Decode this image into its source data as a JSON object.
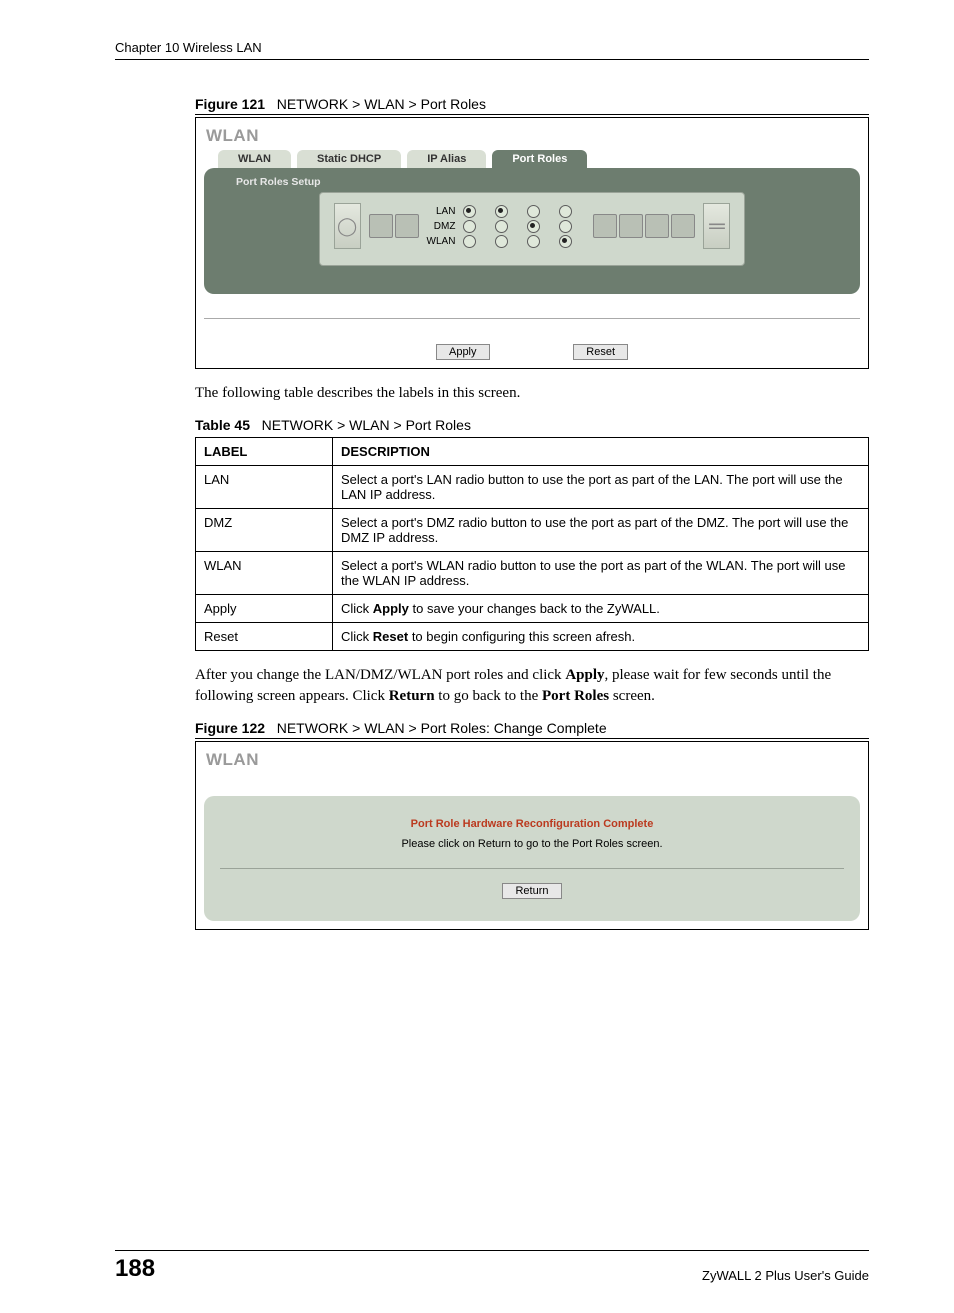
{
  "header": {
    "chapter": "Chapter 10 Wireless LAN"
  },
  "figure1": {
    "caption_num": "Figure 121",
    "caption_text": "NETWORK > WLAN > Port Roles",
    "title": "WLAN",
    "tabs": [
      "WLAN",
      "Static DHCP",
      "IP Alias",
      "Port Roles"
    ],
    "active_tab": 3,
    "panel_head": "Port Roles Setup",
    "row_labels": [
      "LAN",
      "DMZ",
      "WLAN"
    ],
    "selections": [
      [
        true,
        true,
        false,
        false
      ],
      [
        false,
        false,
        true,
        false
      ],
      [
        false,
        false,
        false,
        true
      ]
    ],
    "buttons": {
      "apply": "Apply",
      "reset": "Reset"
    }
  },
  "text1": "The following table describes the labels in this screen.",
  "table": {
    "caption_num": "Table 45",
    "caption_text": "NETWORK > WLAN > Port Roles",
    "headers": [
      "LABEL",
      "DESCRIPTION"
    ],
    "rows": [
      {
        "label": "LAN",
        "desc": "Select a port's LAN radio button to use the port as part of the LAN. The port will use the LAN IP address."
      },
      {
        "label": "DMZ",
        "desc": "Select a port's DMZ radio button to use the port as part of the DMZ. The port will use the DMZ IP address."
      },
      {
        "label": "WLAN",
        "desc": "Select a port's WLAN radio button to use the port as part of the WLAN. The port will use the WLAN IP address."
      },
      {
        "label": "Apply",
        "desc_pre": "Click ",
        "desc_bold": "Apply",
        "desc_post": " to save your changes back to the ZyWALL."
      },
      {
        "label": "Reset",
        "desc_pre": "Click ",
        "desc_bold": "Reset",
        "desc_post": " to begin configuring this screen afresh."
      }
    ]
  },
  "text2": {
    "p1a": "After you change the LAN/DMZ/WLAN port roles and click ",
    "b1": "Apply",
    "p1b": ", please wait for few seconds until the following screen appears. Click ",
    "b2": "Return",
    "p1c": " to go back to the ",
    "b3": "Port Roles",
    "p1d": " screen."
  },
  "figure2": {
    "caption_num": "Figure 122",
    "caption_text": "NETWORK > WLAN > Port Roles: Change Complete",
    "title": "WLAN",
    "msg_title": "Port Role Hardware Reconfiguration Complete",
    "msg_body": "Please click on Return to go to the Port Roles screen.",
    "button": "Return"
  },
  "footer": {
    "page": "188",
    "guide": "ZyWALL 2 Plus User's Guide"
  }
}
